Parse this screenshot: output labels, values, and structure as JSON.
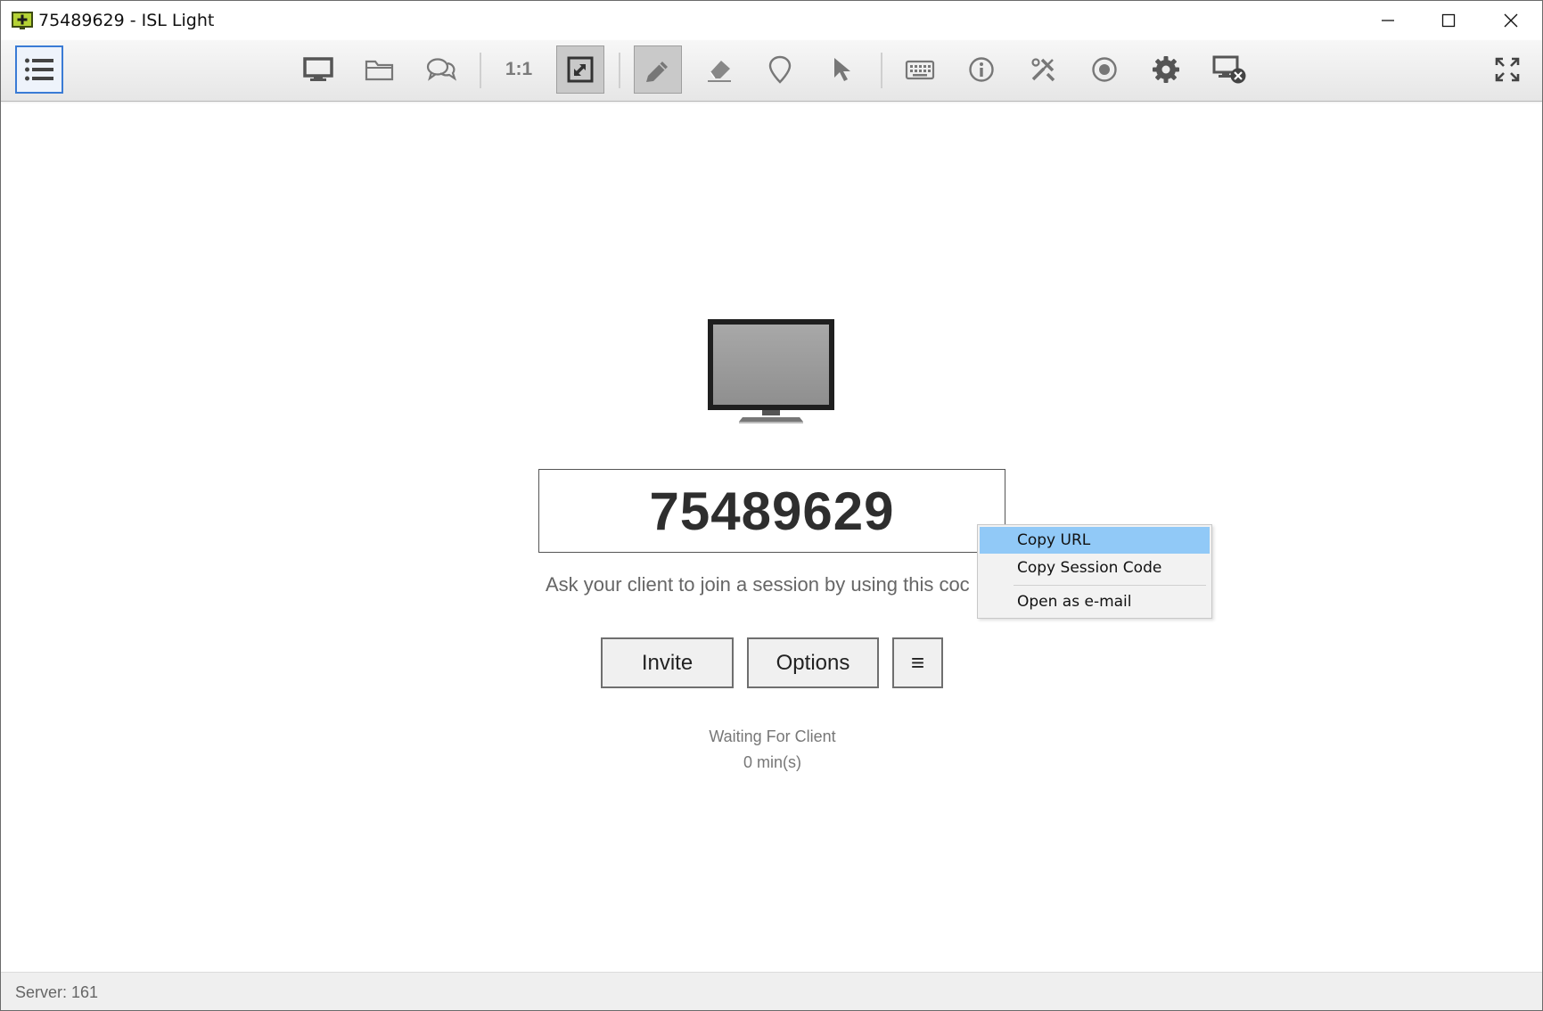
{
  "window": {
    "title": "75489629 - ISL Light"
  },
  "toolbar": {
    "menu_icon": "list-icon",
    "buttons": [
      {
        "name": "desktop-icon"
      },
      {
        "name": "folder-icon"
      },
      {
        "name": "chat-icon"
      },
      {
        "name": "ratio",
        "label": "1:1"
      },
      {
        "name": "fit-screen-icon",
        "active": true
      },
      {
        "name": "pen-icon",
        "active": true
      },
      {
        "name": "eraser-icon"
      },
      {
        "name": "pin-icon"
      },
      {
        "name": "pointer-icon"
      },
      {
        "name": "keyboard-icon"
      },
      {
        "name": "info-icon"
      },
      {
        "name": "tools-icon"
      },
      {
        "name": "record-icon"
      },
      {
        "name": "gear-icon"
      },
      {
        "name": "disconnect-icon"
      },
      {
        "name": "fullscreen-icon"
      }
    ]
  },
  "session": {
    "code": "75489629",
    "hint": "Ask your client to join a session by using this coc",
    "invite_label": "Invite",
    "options_label": "Options",
    "more_label": "≡",
    "status": "Waiting For Client",
    "elapsed": "0 min(s)"
  },
  "context_menu": {
    "items": [
      {
        "label": "Copy URL",
        "highlighted": true
      },
      {
        "label": "Copy Session Code"
      },
      {
        "label": "Open as e-mail"
      }
    ]
  },
  "statusbar": {
    "server": "Server: 161"
  },
  "colors": {
    "highlight": "#91c9f7",
    "menu_button_border": "#3a7bd5",
    "app_icon": "#b5d335"
  }
}
